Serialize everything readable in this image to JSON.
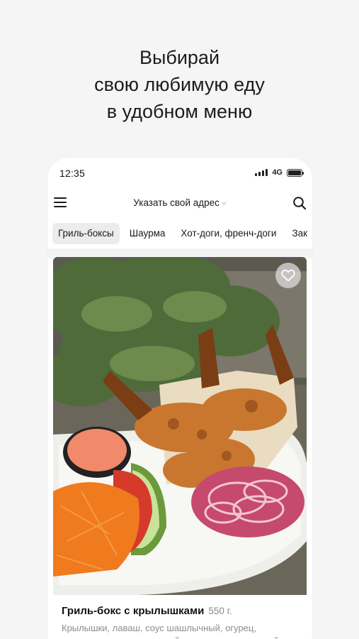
{
  "headline": {
    "line1": "Выбирай",
    "line2": "свою любимую еду",
    "line3": "в удобном меню"
  },
  "status_bar": {
    "time": "12:35",
    "network": "4G",
    "icons": [
      "signal-icon",
      "battery-icon"
    ]
  },
  "app_bar": {
    "menu_icon": "hamburger-menu-icon",
    "address_label": "Указать свой адрес",
    "address_chevron": "⌄",
    "search_icon": "search-icon"
  },
  "category_tabs": [
    {
      "label": "Гриль-боксы",
      "active": true
    },
    {
      "label": "Шаурма",
      "active": false
    },
    {
      "label": "Хот-доги, френч-доги",
      "active": false
    },
    {
      "label": "Зак",
      "active": false
    }
  ],
  "product": {
    "title": "Гриль-бокс с крылышками",
    "weight": "550 г.",
    "description": "Крылышки, лаваш, соус шашлычный, огурец, помидор, морковь по-корейски, лук маринованный",
    "favorite_icon": "heart-outline-icon"
  },
  "colors": {
    "background": "#f5f5f5",
    "active_tab": "#ececec",
    "muted_text": "#8c8c8c"
  }
}
